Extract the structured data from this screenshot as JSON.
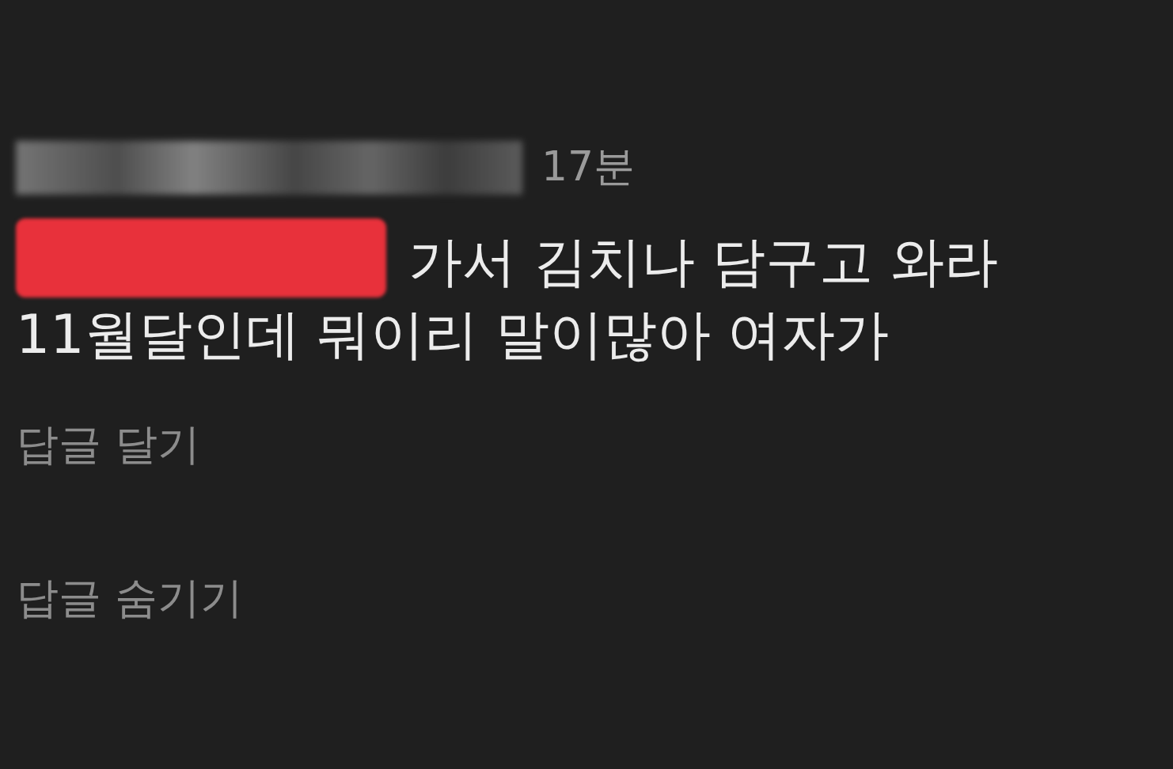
{
  "comment": {
    "time": "17분",
    "lines": [
      "가서 김치나 담구고 와라",
      "11월달인데 뭐이리 말이많아 여자가"
    ]
  },
  "actions": [
    {
      "label": "답글 달기"
    },
    {
      "label": "답글 숨기기"
    }
  ]
}
